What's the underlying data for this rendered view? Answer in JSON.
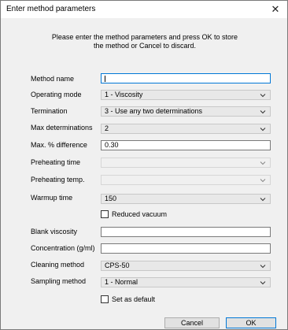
{
  "dialog": {
    "title": "Enter method parameters",
    "close_icon": "close-icon",
    "instructions_line1": "Please enter the method parameters and press OK to store",
    "instructions_line2": "the method or Cancel to discard."
  },
  "fields": {
    "method_name": {
      "label": "Method name",
      "value": ""
    },
    "operating_mode": {
      "label": "Operating mode",
      "value": "1 - Viscosity"
    },
    "termination": {
      "label": "Termination",
      "value": "3 - Use any two determinations"
    },
    "max_determinations": {
      "label": "Max determinations",
      "value": "2"
    },
    "max_difference": {
      "label": "Max. % difference",
      "value": "0.30"
    },
    "preheating_time": {
      "label": "Preheating time",
      "value": ""
    },
    "preheating_temp": {
      "label": "Preheating temp.",
      "value": ""
    },
    "warmup_time": {
      "label": "Warmup time",
      "value": "150"
    },
    "reduced_vacuum": {
      "label": "Reduced vacuum",
      "checked": false
    },
    "blank_viscosity": {
      "label": "Blank viscosity",
      "value": ""
    },
    "concentration": {
      "label": "Concentration (g/ml)",
      "value": ""
    },
    "cleaning_method": {
      "label": "Cleaning method",
      "value": "CPS-50"
    },
    "sampling_method": {
      "label": "Sampling method",
      "value": "1 - Normal"
    },
    "set_as_default": {
      "label": "Set as default",
      "checked": false
    }
  },
  "buttons": {
    "cancel": "Cancel",
    "ok": "OK"
  }
}
